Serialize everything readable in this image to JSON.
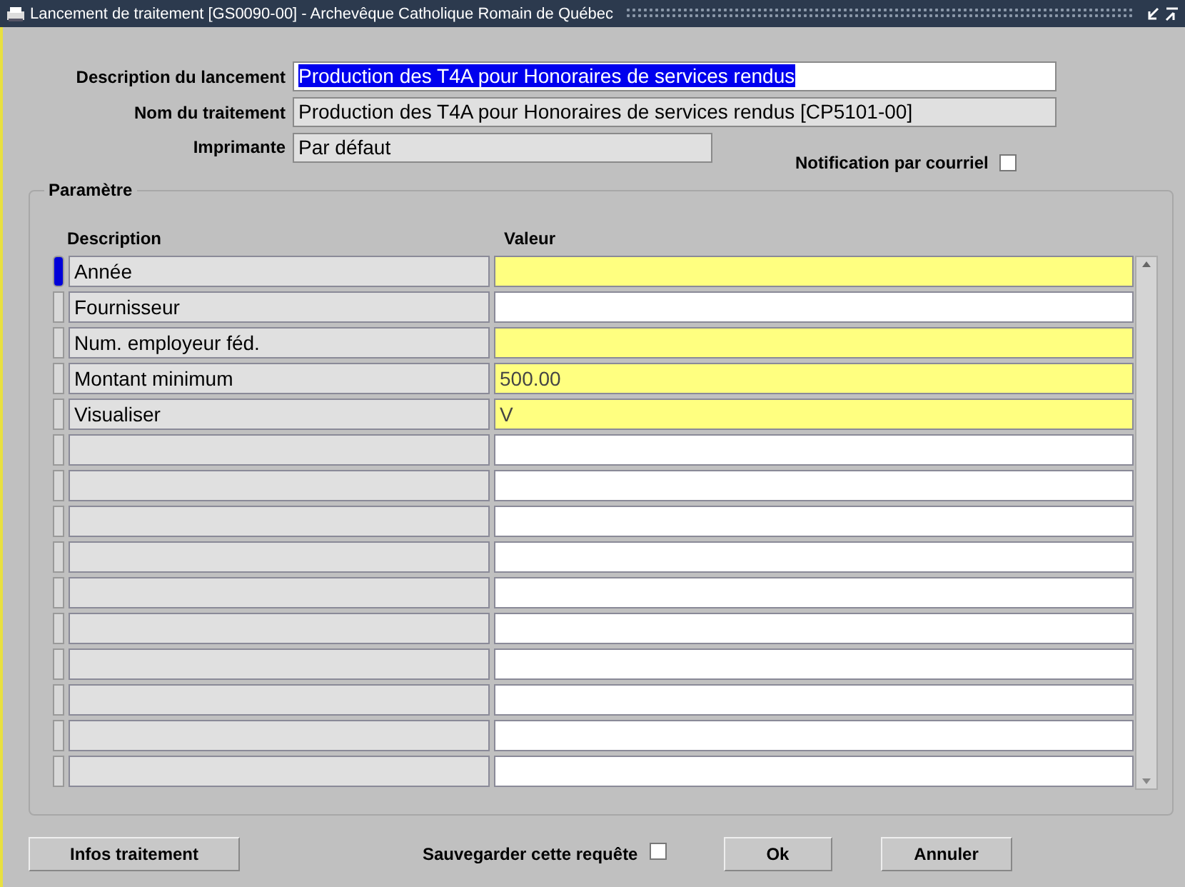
{
  "window": {
    "title": "Lancement de traitement [GS0090-00] - Archevêque Catholique Romain de Québec"
  },
  "form": {
    "description": {
      "label": "Description du lancement",
      "value": "Production des T4A pour Honoraires de services rendus",
      "highlighted": true
    },
    "process_name": {
      "label": "Nom du traitement",
      "value": "Production des T4A pour Honoraires de services rendus [CP5101-00]"
    },
    "printer": {
      "label": "Imprimante",
      "value": "Par défaut"
    },
    "email_notification": {
      "label": "Notification par courriel",
      "checked": false
    }
  },
  "parameters": {
    "title": "Paramètre",
    "columns": [
      "Description",
      "Valeur"
    ],
    "rows": [
      {
        "description": "Année",
        "required": true,
        "selected": true
      },
      {
        "description": "Fournisseur",
        "required": false,
        "selected": false
      },
      {
        "description": "Num. employeur féd.",
        "required": true,
        "selected": false
      },
      {
        "description": "Montant minimum",
        "value": "500.00",
        "required": true,
        "selected": false
      },
      {
        "description": "Visualiser",
        "value": "V",
        "required": true,
        "selected": false
      },
      {
        "required": false,
        "selected": false
      },
      {
        "required": false,
        "selected": false
      },
      {
        "required": false,
        "selected": false
      },
      {
        "required": false,
        "selected": false
      },
      {
        "required": false,
        "selected": false
      },
      {
        "required": false,
        "selected": false
      },
      {
        "required": false,
        "selected": false
      },
      {
        "required": false,
        "selected": false
      },
      {
        "required": false,
        "selected": false
      },
      {
        "required": false,
        "selected": false
      }
    ]
  },
  "footer": {
    "info_button": "Infos traitement",
    "save_query": {
      "label": "Sauvegarder cette requête",
      "checked": false
    },
    "buttons": [
      "Ok",
      "Annuler"
    ]
  }
}
